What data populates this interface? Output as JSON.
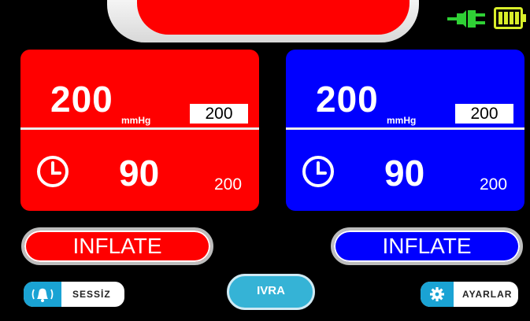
{
  "status": {
    "plug_icon": "power-plug-icon",
    "battery_icon": "battery-full-icon",
    "banner_color": "#ff0000"
  },
  "left_cuff": {
    "color": "#ff0000",
    "pressure": "200",
    "unit": "mmHg",
    "set_pressure": "200",
    "time": "90",
    "set_time": "200",
    "inflate_label": "INFLATE"
  },
  "right_cuff": {
    "color": "#0000ff",
    "pressure": "200",
    "unit": "mmHg",
    "set_pressure": "200",
    "time": "90",
    "set_time": "200",
    "inflate_label": "INFLATE"
  },
  "footer": {
    "mute_label": "SESSİZ",
    "ivra_label": "IVRA",
    "settings_label": "AYARLAR",
    "accent_color": "#1aa3d4"
  }
}
